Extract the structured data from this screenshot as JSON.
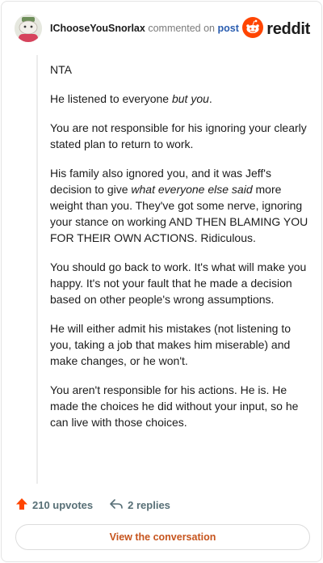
{
  "header": {
    "author": "IChooseYouSnorlax",
    "commented_text": "commented on",
    "post_link": "post",
    "brand": "reddit",
    "avatar_icon": "snoo-avatar-icon",
    "logo_icon": "reddit-snoo-logo-icon"
  },
  "comment": {
    "p1": "NTA",
    "p2_before": "He listened to everyone ",
    "p2_em": "but you",
    "p2_after": ".",
    "p3": "You are not responsible for his ignoring your clearly stated plan to return to work.",
    "p4_before": "His family also ignored you, and it was Jeff's decision to give ",
    "p4_em": "what everyone else said",
    "p4_after": " more weight than you. They've got some nerve, ignoring your stance on working AND THEN BLAMING YOU FOR THEIR OWN ACTIONS. Ridiculous.",
    "p5": "You should go back to work. It's what will make you happy. It's not your fault that he made a decision based on other people's wrong assumptions.",
    "p6": "He will either admit his mistakes (not listening to you, taking a job that makes him miserable) and make changes, or he won't.",
    "p7": "You aren't responsible for his actions. He is. He made the choices he did without your input, so he can live with those choices."
  },
  "stats": {
    "upvotes": "210 upvotes",
    "replies": "2 replies",
    "upvote_icon": "upvote-arrow-icon",
    "reply_icon": "reply-arrow-icon"
  },
  "actions": {
    "view_conversation": "View the conversation"
  },
  "colors": {
    "upvote": "#ff4500",
    "reddit_orange": "#ff4500",
    "link_blue": "#2a5db0",
    "button_text": "#c6541d",
    "meta_gray": "#576f76"
  }
}
